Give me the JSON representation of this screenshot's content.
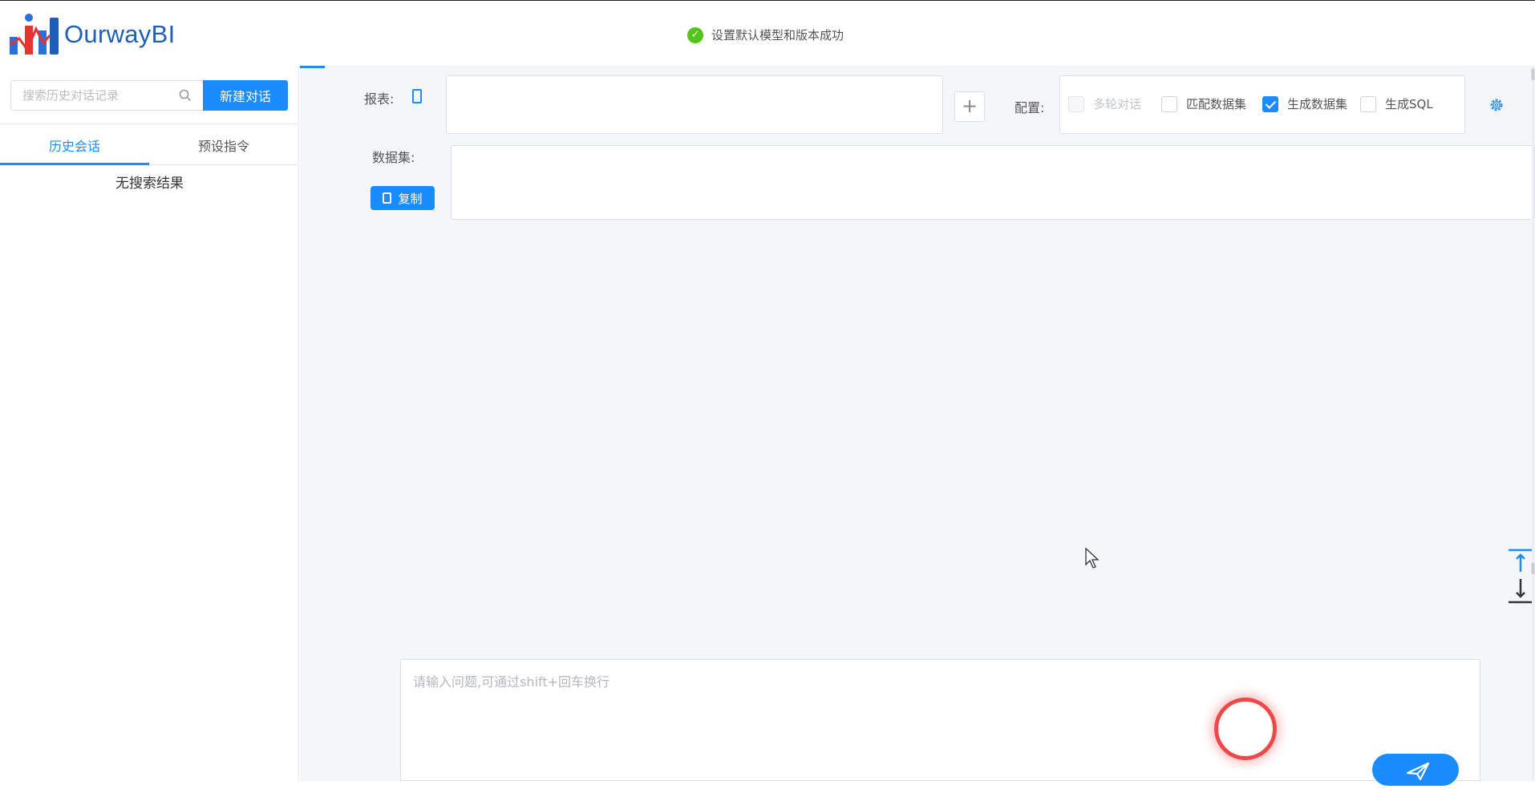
{
  "app": {
    "name": "OurwayBI"
  },
  "toast": {
    "message": "设置默认模型和版本成功",
    "icon": "check-circle-icon",
    "color": "#52c41a"
  },
  "sidebar": {
    "search": {
      "placeholder": "搜索历史对话记录",
      "value": ""
    },
    "new_chat_label": "新建对话",
    "tabs": [
      {
        "label": "历史会话",
        "active": true
      },
      {
        "label": "预设指令",
        "active": false
      }
    ],
    "empty_text": "无搜索结果"
  },
  "main": {
    "report_label": "报表:",
    "config_label": "配置:",
    "config_options": [
      {
        "label": "多轮对话",
        "checked": false,
        "disabled": true
      },
      {
        "label": "匹配数据集",
        "checked": false,
        "disabled": false
      },
      {
        "label": "生成数据集",
        "checked": true,
        "disabled": false
      },
      {
        "label": "生成SQL",
        "checked": false,
        "disabled": false
      }
    ],
    "dataset_label": "数据集:",
    "copy_label": "复制",
    "input": {
      "placeholder": "请输入问题,可通过shift+回车换行",
      "value": ""
    }
  },
  "colors": {
    "accent": "#1a8cff",
    "brand": "#1f5fb8"
  }
}
